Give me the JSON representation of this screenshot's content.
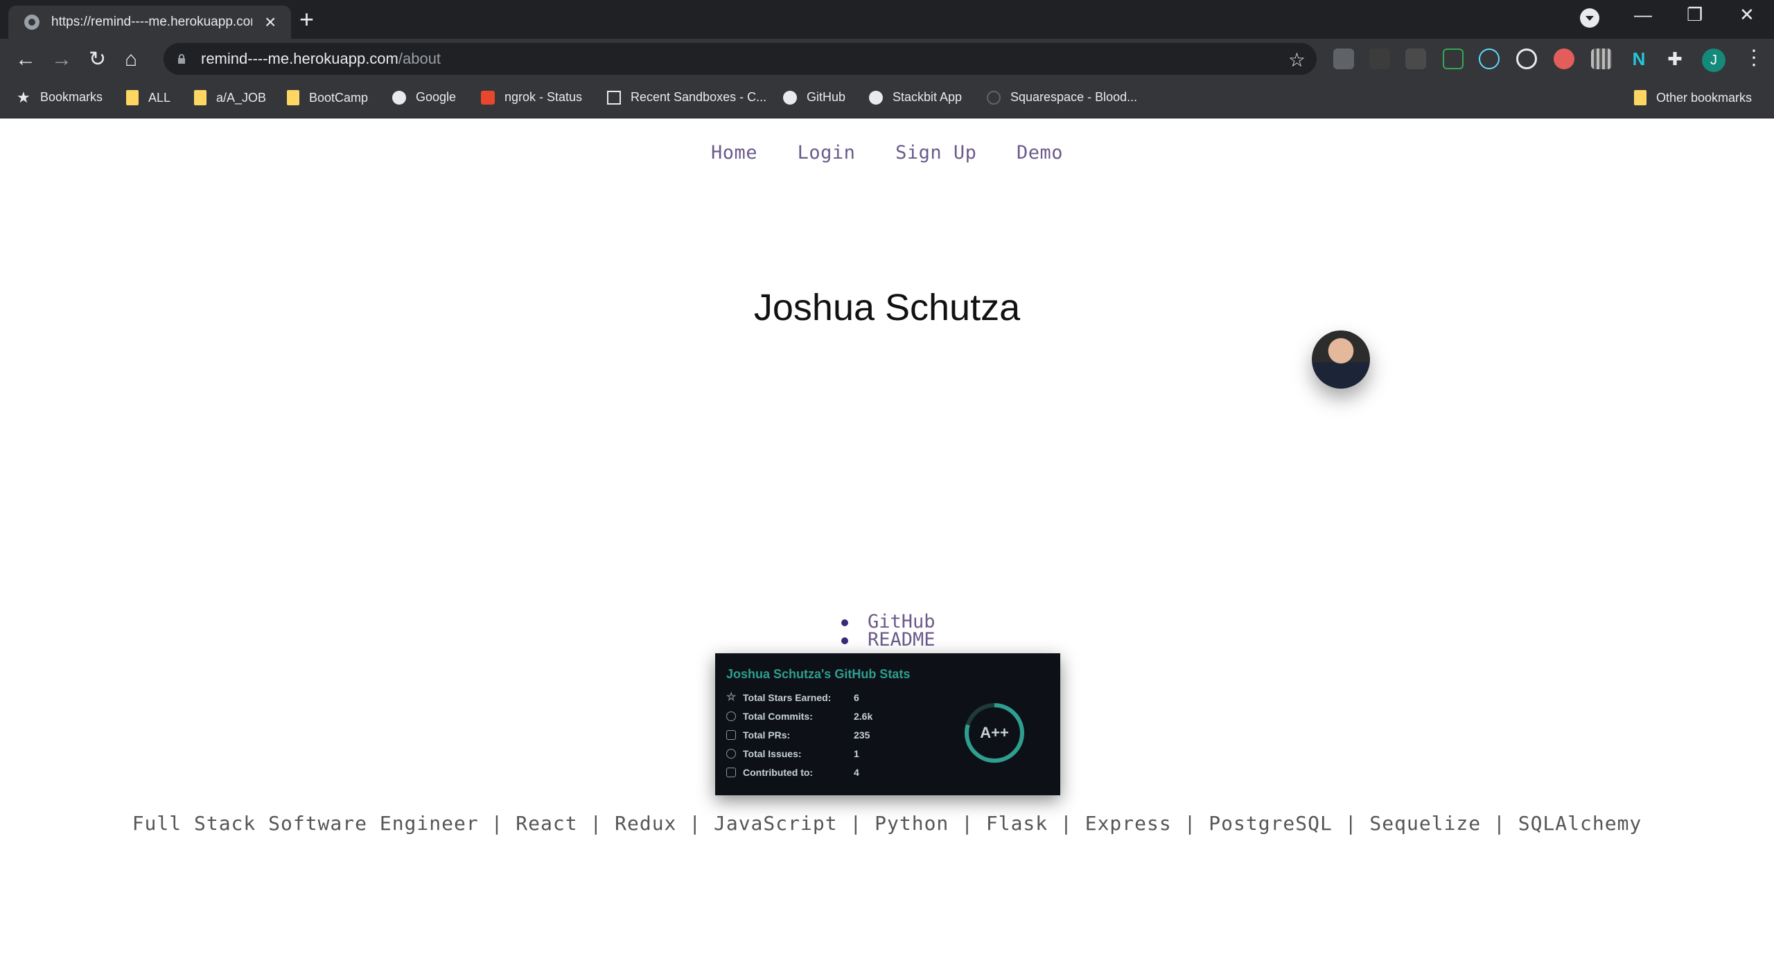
{
  "browser": {
    "tab_title": "https://remind----me.herokuapp.com",
    "url_host": "remind----me.herokuapp.com",
    "url_path": "/about",
    "avatar_letter": "J",
    "bookmarks": [
      {
        "label": "Bookmarks",
        "icon": "star-icon"
      },
      {
        "label": "ALL",
        "icon": "folder-icon"
      },
      {
        "label": "a/A_JOB",
        "icon": "folder-icon"
      },
      {
        "label": "BootCamp",
        "icon": "folder-icon"
      },
      {
        "label": "Google",
        "icon": "globe-icon"
      },
      {
        "label": "ngrok - Status",
        "icon": "ngrok-icon"
      },
      {
        "label": "Recent Sandboxes - C...",
        "icon": "codesandbox-icon"
      },
      {
        "label": "GitHub",
        "icon": "github-icon"
      },
      {
        "label": "Stackbit App",
        "icon": "globe-icon"
      },
      {
        "label": "Squarespace - Blood...",
        "icon": "squarespace-icon"
      }
    ],
    "other_bookmarks": "Other bookmarks"
  },
  "nav": {
    "home": "Home",
    "login": "Login",
    "signup": "Sign Up",
    "demo": "Demo"
  },
  "profile": {
    "name": "Joshua Schutza",
    "links": [
      "GitHub",
      "README"
    ]
  },
  "github_stats": {
    "title": "Joshua Schutza's GitHub Stats",
    "rows": [
      {
        "label": "Total Stars Earned:",
        "value": "6"
      },
      {
        "label": "Total Commits:",
        "value": "2.6k"
      },
      {
        "label": "Total PRs:",
        "value": "235"
      },
      {
        "label": "Total Issues:",
        "value": "1"
      },
      {
        "label": "Contributed to:",
        "value": "4"
      }
    ],
    "grade": "A++",
    "accent_color": "#2f9e8f"
  },
  "skills": "Full Stack Software Engineer | React | Redux | JavaScript | Python | Flask | Express | PostgreSQL | Sequelize | SQLAlchemy"
}
